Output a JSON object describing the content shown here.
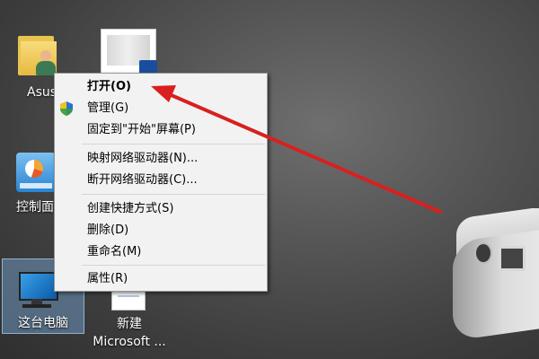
{
  "desktop": {
    "icons": [
      {
        "label": "Asus"
      },
      {
        "label": ""
      },
      {
        "label": "控制面"
      },
      {
        "label": "这台电脑"
      },
      {
        "label_line1": "新建",
        "label_line2": "Microsoft ..."
      }
    ]
  },
  "context_menu": {
    "items": [
      {
        "label": "打开(O)"
      },
      {
        "label": "管理(G)"
      },
      {
        "label": "固定到\"开始\"屏幕(P)"
      },
      {
        "label": "映射网络驱动器(N)..."
      },
      {
        "label": "断开网络驱动器(C)..."
      },
      {
        "label": "创建快捷方式(S)"
      },
      {
        "label": "删除(D)"
      },
      {
        "label": "重命名(M)"
      },
      {
        "label": "属性(R)"
      }
    ]
  },
  "colors": {
    "arrow": "#d9201f",
    "menu_bg": "#f2f2f2",
    "selection": "#78aadc"
  }
}
